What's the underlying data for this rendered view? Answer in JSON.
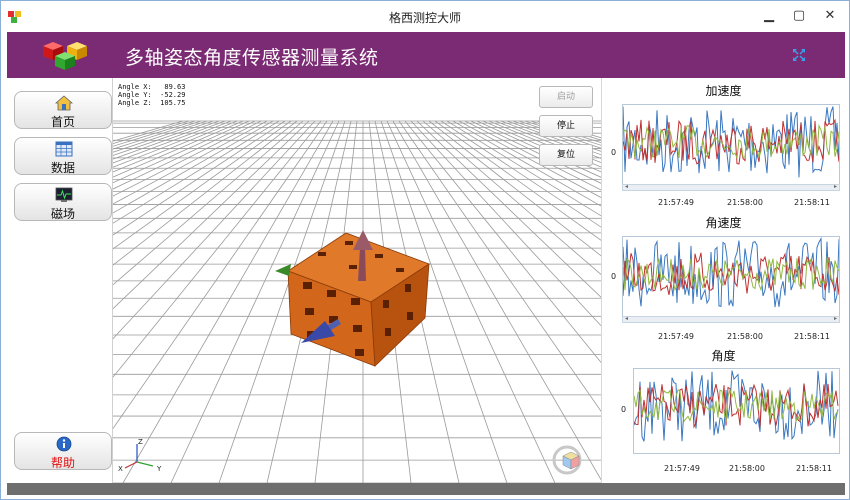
{
  "window": {
    "title": "格西测控大师",
    "minimize": "▁",
    "maximize": "▢",
    "close": "✕"
  },
  "header": {
    "title": "多轴姿态角度传感器测量系统"
  },
  "sidebar": {
    "items": [
      {
        "label": "首页",
        "icon": "home-icon"
      },
      {
        "label": "数据",
        "icon": "table-icon"
      },
      {
        "label": "磁场",
        "icon": "monitor-icon"
      },
      {
        "label": "帮助",
        "icon": "info-icon"
      }
    ]
  },
  "viewport": {
    "readout": [
      {
        "label": "Angle X:",
        "value": "89.63"
      },
      {
        "label": "Angle Y:",
        "value": "-52.29"
      },
      {
        "label": "Angle Z:",
        "value": "105.75"
      }
    ],
    "buttons": {
      "start": "启动",
      "stop": "停止",
      "reset": "复位"
    },
    "axes": {
      "x": "X",
      "y": "Y",
      "z": "Z"
    }
  },
  "charts": [
    {
      "title": "加速度",
      "y_label": "0",
      "x_ticks": [
        "21:57:49",
        "21:58:00",
        "21:58:11"
      ]
    },
    {
      "title": "角速度",
      "y_label": "0",
      "x_ticks": [
        "21:57:49",
        "21:58:00",
        "21:58:11"
      ]
    },
    {
      "title": "角度",
      "y_label": "0",
      "x_ticks": [
        "21:57:49",
        "21:58:00",
        "21:58:11"
      ]
    }
  ],
  "colors": {
    "header": "#7b2a74",
    "series_blue": "#3a78c0",
    "series_red": "#c03030",
    "series_green": "#90b840",
    "cube": "#d2661a"
  }
}
